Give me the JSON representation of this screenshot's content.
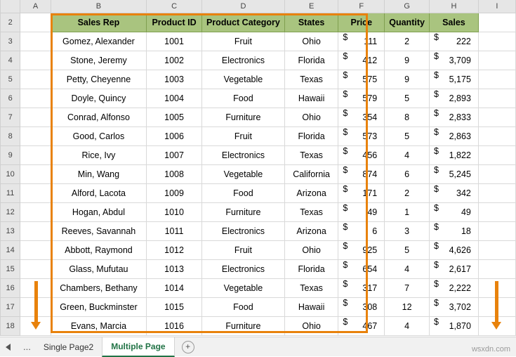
{
  "spreadsheet": {
    "column_headers": [
      "A",
      "B",
      "C",
      "D",
      "E",
      "F",
      "G",
      "H",
      "I"
    ],
    "row_headers": [
      "2",
      "3",
      "4",
      "5",
      "6",
      "7",
      "8",
      "9",
      "10",
      "11",
      "12",
      "13",
      "14",
      "15",
      "16",
      "17",
      "18"
    ],
    "table_headers": [
      "Sales Rep",
      "Product ID",
      "Product Category",
      "States",
      "Price",
      "Quantity",
      "Sales"
    ],
    "rows": [
      {
        "rep": "Gomez, Alexander",
        "id": "1001",
        "category": "Fruit",
        "state": "Ohio",
        "currency": "$",
        "price": "111",
        "qty": "2",
        "sales_currency": "$",
        "sales": "222"
      },
      {
        "rep": "Stone, Jeremy",
        "id": "1002",
        "category": "Electronics",
        "state": "Florida",
        "currency": "$",
        "price": "412",
        "qty": "9",
        "sales_currency": "$",
        "sales": "3,709"
      },
      {
        "rep": "Petty, Cheyenne",
        "id": "1003",
        "category": "Vegetable",
        "state": "Texas",
        "currency": "$",
        "price": "575",
        "qty": "9",
        "sales_currency": "$",
        "sales": "5,175"
      },
      {
        "rep": "Doyle, Quincy",
        "id": "1004",
        "category": "Food",
        "state": "Hawaii",
        "currency": "$",
        "price": "579",
        "qty": "5",
        "sales_currency": "$",
        "sales": "2,893"
      },
      {
        "rep": "Conrad, Alfonso",
        "id": "1005",
        "category": "Furniture",
        "state": "Ohio",
        "currency": "$",
        "price": "354",
        "qty": "8",
        "sales_currency": "$",
        "sales": "2,833"
      },
      {
        "rep": "Good, Carlos",
        "id": "1006",
        "category": "Fruit",
        "state": "Florida",
        "currency": "$",
        "price": "573",
        "qty": "5",
        "sales_currency": "$",
        "sales": "2,863"
      },
      {
        "rep": "Rice, Ivy",
        "id": "1007",
        "category": "Electronics",
        "state": "Texas",
        "currency": "$",
        "price": "456",
        "qty": "4",
        "sales_currency": "$",
        "sales": "1,822"
      },
      {
        "rep": "Min, Wang",
        "id": "1008",
        "category": "Vegetable",
        "state": "California",
        "currency": "$",
        "price": "874",
        "qty": "6",
        "sales_currency": "$",
        "sales": "5,245"
      },
      {
        "rep": "Alford, Lacota",
        "id": "1009",
        "category": "Food",
        "state": "Arizona",
        "currency": "$",
        "price": "171",
        "qty": "2",
        "sales_currency": "$",
        "sales": "342"
      },
      {
        "rep": "Hogan, Abdul",
        "id": "1010",
        "category": "Furniture",
        "state": "Texas",
        "currency": "$",
        "price": "49",
        "qty": "1",
        "sales_currency": "$",
        "sales": "49"
      },
      {
        "rep": "Reeves, Savannah",
        "id": "1011",
        "category": "Electronics",
        "state": "Arizona",
        "currency": "$",
        "price": "6",
        "qty": "3",
        "sales_currency": "$",
        "sales": "18"
      },
      {
        "rep": "Abbott, Raymond",
        "id": "1012",
        "category": "Fruit",
        "state": "Ohio",
        "currency": "$",
        "price": "925",
        "qty": "5",
        "sales_currency": "$",
        "sales": "4,626"
      },
      {
        "rep": "Glass, Mufutau",
        "id": "1013",
        "category": "Electronics",
        "state": "Florida",
        "currency": "$",
        "price": "654",
        "qty": "4",
        "sales_currency": "$",
        "sales": "2,617"
      },
      {
        "rep": "Chambers, Bethany",
        "id": "1014",
        "category": "Vegetable",
        "state": "Texas",
        "currency": "$",
        "price": "317",
        "qty": "7",
        "sales_currency": "$",
        "sales": "2,222"
      },
      {
        "rep": "Green, Buckminster",
        "id": "1015",
        "category": "Food",
        "state": "Hawaii",
        "currency": "$",
        "price": "308",
        "qty": "12",
        "sales_currency": "$",
        "sales": "3,702"
      },
      {
        "rep": "Evans, Marcia",
        "id": "1016",
        "category": "Furniture",
        "state": "Ohio",
        "currency": "$",
        "price": "467",
        "qty": "4",
        "sales_currency": "$",
        "sales": "1,870"
      }
    ]
  },
  "annotation": {
    "print_area_border_color": "#e8820c",
    "arrow_color": "#e8820c"
  },
  "tabbar": {
    "overflow_dots": "...",
    "tabs": [
      {
        "label": "Single Page2",
        "active": false
      },
      {
        "label": "Multiple Page",
        "active": true
      }
    ],
    "add_sheet_label": "+"
  },
  "watermark": "wsxdn.com"
}
